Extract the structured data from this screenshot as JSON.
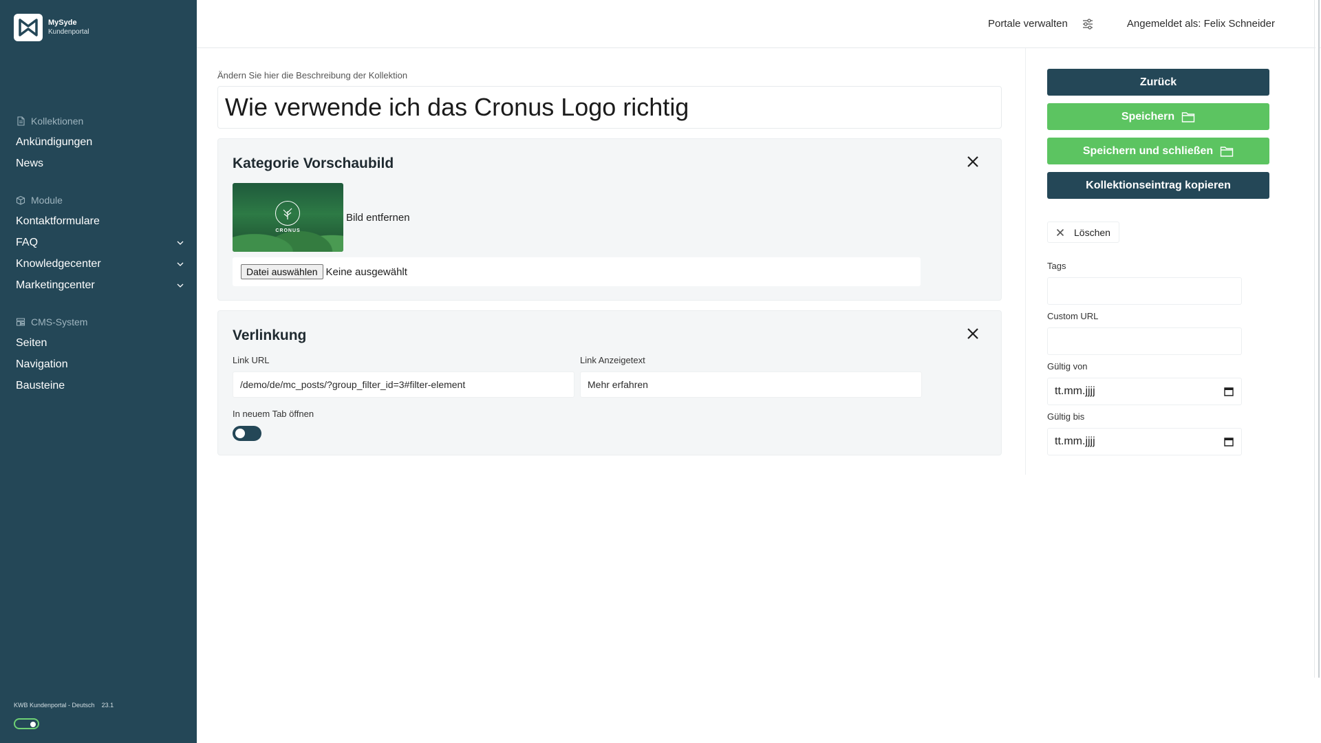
{
  "brand": {
    "name": "MySyde",
    "subtitle": "Kundenportal"
  },
  "sidebar": {
    "sections": [
      {
        "heading": "Kollektionen",
        "icon": "document-icon",
        "items": [
          {
            "label": "Ankündigungen",
            "expandable": false
          },
          {
            "label": "News",
            "expandable": false
          }
        ]
      },
      {
        "heading": "Module",
        "icon": "box-icon",
        "items": [
          {
            "label": "Kontaktformulare",
            "expandable": false
          },
          {
            "label": "FAQ",
            "expandable": true
          },
          {
            "label": "Knowledgecenter",
            "expandable": true
          },
          {
            "label": "Marketingcenter",
            "expandable": true
          }
        ]
      },
      {
        "heading": "CMS-System",
        "icon": "cms-icon",
        "items": [
          {
            "label": "Seiten",
            "expandable": false
          },
          {
            "label": "Navigation",
            "expandable": false
          },
          {
            "label": "Bausteine",
            "expandable": false
          }
        ]
      }
    ],
    "footer": {
      "portal": "KWB Kundenportal - Deutsch",
      "version": "23.1",
      "toggle_on": true
    }
  },
  "header": {
    "portale_label": "Portale verwalten",
    "logged_in": "Angemeldet als: Felix Schneider"
  },
  "main": {
    "description_label": "Ändern Sie hier die Beschreibung der Kollektion",
    "title_value": "Wie verwende ich das Cronus Logo richtig",
    "category_card": {
      "title": "Kategorie Vorschaubild",
      "image_caption": "CRONUS",
      "remove_image": "Bild entfernen",
      "file_button": "Datei auswählen",
      "file_status": "Keine ausgewählt"
    },
    "link_card": {
      "title": "Verlinkung",
      "url_label": "Link URL",
      "url_value": "/demo/de/mc_posts/?group_filter_id=3#filter-element",
      "text_label": "Link Anzeigetext",
      "text_value": "Mehr erfahren",
      "newtab_label": "In neuem Tab öffnen",
      "newtab_on": false
    }
  },
  "right": {
    "back": "Zurück",
    "save": "Speichern",
    "save_close": "Speichern und schließen",
    "copy": "Kollektionseintrag kopieren",
    "delete": "Löschen",
    "tags_label": "Tags",
    "tags_value": "",
    "custom_url_label": "Custom URL",
    "custom_url_value": "",
    "valid_from_label": "Gültig von",
    "valid_from_value": "tt.mm.jjjj",
    "valid_to_label": "Gültig bis",
    "valid_to_value": "tt.mm.jjjj"
  },
  "colors": {
    "sidebar": "#244757",
    "green": "#5cc461",
    "dark_button": "#244757"
  }
}
